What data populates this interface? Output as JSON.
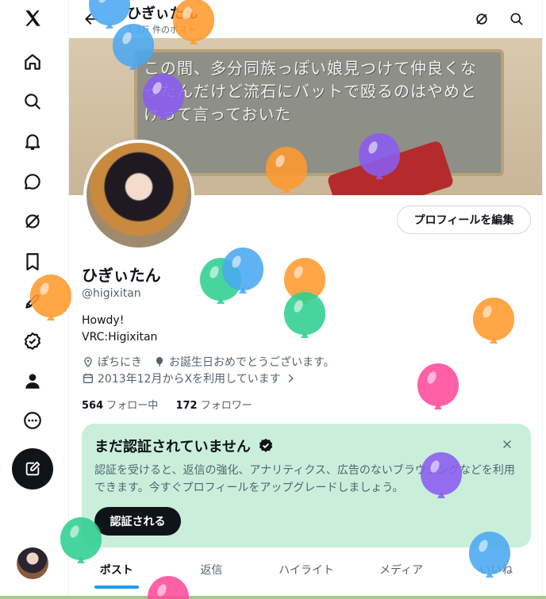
{
  "nav": {
    "items": [
      {
        "name": "x-logo-icon",
        "label": "X"
      },
      {
        "name": "home-icon"
      },
      {
        "name": "search-icon"
      },
      {
        "name": "notifications-icon"
      },
      {
        "name": "messages-icon"
      },
      {
        "name": "grok-icon"
      },
      {
        "name": "bookmarks-icon"
      },
      {
        "name": "jobs-icon"
      },
      {
        "name": "verified-icon"
      },
      {
        "name": "profile-icon"
      },
      {
        "name": "more-icon"
      }
    ],
    "compose": "compose-icon"
  },
  "header": {
    "title": "ひぎぃたん",
    "subtitle": "1.3万 件のポスト"
  },
  "banner": {
    "text": "この間、多分同族っぽい娘見つけて仲良くなったんだけど流石にバットで殴るのはやめとけって言っておいた"
  },
  "profile": {
    "edit_label": "プロフィールを編集",
    "name": "ひぎぃたん",
    "handle": "@higixitan",
    "bio_line1": "Howdy!",
    "bio_line2": "VRC:Higixitan",
    "location": "ぽちにき",
    "birthday": "お誕生日おめでとうございます。",
    "joined": "2013年12月からXを利用しています",
    "following_count": "564",
    "following_label": "フォロー中",
    "followers_count": "172",
    "followers_label": "フォロワー"
  },
  "verify": {
    "title": "まだ認証されていません",
    "body": "認証を受けると、返信の強化、アナリティクス、広告のないブラウジングなどを利用できます。今すぐプロフィールをアップグレードしましょう。",
    "button": "認証される"
  },
  "tabs": [
    "ポスト",
    "返信",
    "ハイライト",
    "メディア",
    "いいね"
  ],
  "balloon_colors": {
    "orange": "#ff9a2e",
    "blue": "#4aa9f0",
    "purple": "#8a5cf0",
    "green": "#2ecf8f",
    "pink": "#ff4a9a"
  }
}
